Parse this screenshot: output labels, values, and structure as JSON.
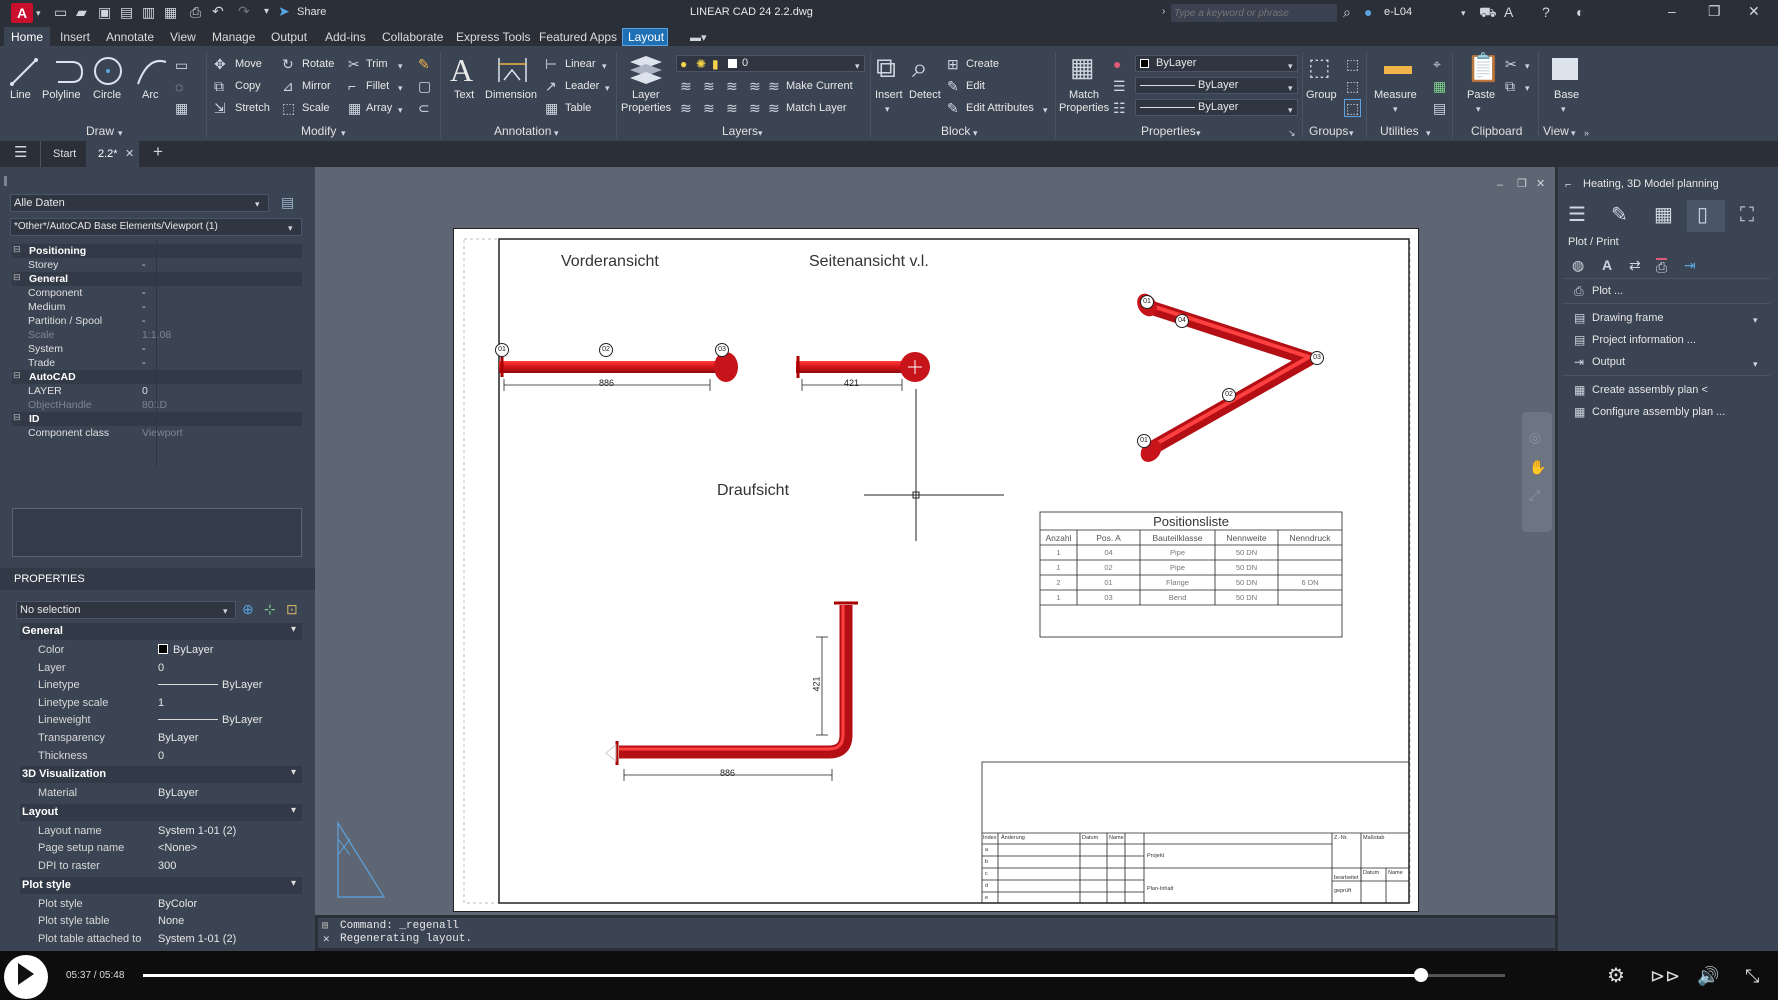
{
  "titlebar": {
    "title": "LINEAR CAD 24   2.2.dwg",
    "share": "Share",
    "search_placeholder": "Type a keyword or phrase",
    "user": "e-L04"
  },
  "ribbon_tabs": [
    "Home",
    "Insert",
    "Annotate",
    "View",
    "Manage",
    "Output",
    "Add-ins",
    "Collaborate",
    "Express Tools",
    "Featured Apps",
    "Layout"
  ],
  "draw": {
    "title": "Draw",
    "line": "Line",
    "polyline": "Polyline",
    "circle": "Circle",
    "arc": "Arc"
  },
  "modify": {
    "title": "Modify",
    "move": "Move",
    "rotate": "Rotate",
    "trim": "Trim",
    "copy": "Copy",
    "mirror": "Mirror",
    "fillet": "Fillet",
    "stretch": "Stretch",
    "scale": "Scale",
    "array": "Array"
  },
  "annotation": {
    "title": "Annotation",
    "text": "Text",
    "dimension": "Dimension",
    "linear": "Linear",
    "leader": "Leader",
    "table": "Table"
  },
  "layers": {
    "title": "Layers",
    "layer_properties_1": "Layer",
    "layer_properties_2": "Properties",
    "current": "0",
    "make_current": "Make Current",
    "match_layer": "Match Layer"
  },
  "block": {
    "title": "Block",
    "insert": "Insert",
    "detect": "Detect",
    "create": "Create",
    "edit": "Edit",
    "edit_attributes": "Edit Attributes"
  },
  "properties": {
    "title": "Properties",
    "match_1": "Match",
    "match_2": "Properties",
    "color": "ByLayer",
    "linetype": "ByLayer",
    "lineweight": "ByLayer"
  },
  "groups": {
    "title": "Groups",
    "group": "Group"
  },
  "utilities": {
    "title": "Utilities",
    "measure": "Measure"
  },
  "clipboard": {
    "title": "Clipboard",
    "paste": "Paste"
  },
  "view": {
    "title": "View",
    "base": "Base"
  },
  "doctabs": {
    "start": "Start",
    "current": "2.2*"
  },
  "left_top": {
    "filter": "Alle Daten",
    "path": "*Other*/AutoCAD Base Elements/Viewport (1)",
    "rows": [
      {
        "k": "Positioning",
        "sec": true
      },
      {
        "k": "Storey",
        "v": "-"
      },
      {
        "k": "General",
        "sec": true
      },
      {
        "k": "Component",
        "v": "-"
      },
      {
        "k": "Medium",
        "v": "-"
      },
      {
        "k": "Partition / Spool",
        "v": "-"
      },
      {
        "k": "Scale",
        "v": "1:1.08",
        "dim": true
      },
      {
        "k": "System",
        "v": "-"
      },
      {
        "k": "Trade",
        "v": "-"
      },
      {
        "k": "AutoCAD",
        "sec": true
      },
      {
        "k": "LAYER",
        "v": "0"
      },
      {
        "k": "ObjectHandle",
        "v": "801D",
        "dim": true
      },
      {
        "k": "ID",
        "sec": true
      },
      {
        "k": "Component class",
        "v": "Viewport",
        "dimv": true
      }
    ]
  },
  "properties_panel": {
    "header": "PROPERTIES",
    "selection": "No selection",
    "rows": [
      {
        "k": "General",
        "sec": true
      },
      {
        "k": "Color",
        "v": "ByLayer",
        "swatch": true
      },
      {
        "k": "Layer",
        "v": "0"
      },
      {
        "k": "Linetype",
        "v": "ByLayer",
        "line": true
      },
      {
        "k": "Linetype scale",
        "v": "1"
      },
      {
        "k": "Lineweight",
        "v": "ByLayer",
        "line": true
      },
      {
        "k": "Transparency",
        "v": "ByLayer"
      },
      {
        "k": "Thickness",
        "v": "0"
      },
      {
        "k": "3D Visualization",
        "sec": true
      },
      {
        "k": "Material",
        "v": "ByLayer"
      },
      {
        "k": "Layout",
        "sec": true
      },
      {
        "k": "Layout name",
        "v": "System 1-01 (2)"
      },
      {
        "k": "Page setup name",
        "v": "<None>",
        "dimv": true
      },
      {
        "k": "DPI to raster",
        "v": "300"
      },
      {
        "k": "Plot style",
        "sec": true
      },
      {
        "k": "Plot style",
        "v": "ByColor",
        "dimv": true
      },
      {
        "k": "Plot style table",
        "v": "None"
      },
      {
        "k": "Plot table attached to",
        "v": "System 1-01 (2)",
        "dimv": true
      }
    ]
  },
  "drawing": {
    "front_view": "Vorderansicht",
    "side_view": "Seitenansicht v.l.",
    "top_view": "Draufsicht",
    "dim_886": "886",
    "dim_421": "421",
    "labels": [
      "01",
      "02",
      "03",
      "04"
    ],
    "table": {
      "title": "Positionsliste",
      "headers": [
        "Anzahl",
        "Pos. A",
        "Bauteilklasse",
        "Nennweite",
        "Nenndruck"
      ],
      "rows": [
        [
          "1",
          "04",
          "Pipe",
          "50 DN",
          ""
        ],
        [
          "1",
          "02",
          "Pipe",
          "50 DN",
          ""
        ],
        [
          "2",
          "01",
          "Flange",
          "50 DN",
          "6 DN"
        ],
        [
          "1",
          "03",
          "Bend",
          "50 DN",
          ""
        ]
      ]
    },
    "titleblock": {
      "index": "Index",
      "change": "Änderung",
      "date": "Datum",
      "name": "Name",
      "rows": [
        "a",
        "b",
        "c",
        "d",
        "e"
      ],
      "project": "Projekt",
      "plan": "Plan-Inhalt",
      "znr": "Z.-Nr.",
      "scale": "Maßstab",
      "datum": "Datum",
      "name2": "Name",
      "bearbeitet": "bearbeitet",
      "geprueft": "geprüft"
    }
  },
  "right_panel": {
    "title": "Heating, 3D Model planning",
    "section": "Plot / Print",
    "items": [
      "Plot ...",
      "Drawing frame",
      "Project information ...",
      "Output",
      "Create assembly plan <",
      "Configure assembly plan ..."
    ]
  },
  "command": {
    "line1": "Command: _regenall",
    "line2": "Regenerating layout."
  },
  "player": {
    "time": "05:37 / 05:48",
    "progress": 0.938
  }
}
